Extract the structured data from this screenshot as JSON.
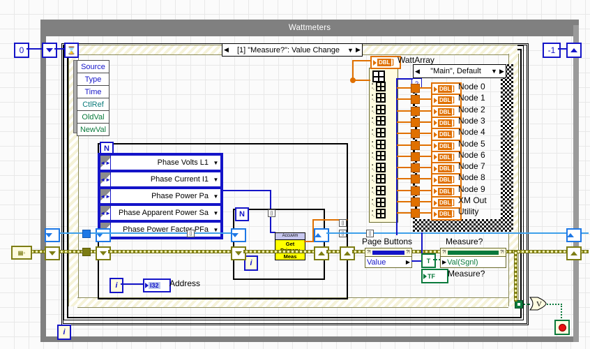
{
  "window": {
    "title": "Wattmeters"
  },
  "event_structure": {
    "case_label": "[1] \"Measure?\": Value Change",
    "left_arrow": "◀",
    "right_arrow": "▶",
    "dropdown_arrow": "▼",
    "timeout_icon": "⌛",
    "data_node": [
      {
        "label": "Source",
        "color": "#1414c8"
      },
      {
        "label": "Type",
        "color": "#1414c8"
      },
      {
        "label": "Time",
        "color": "#1414c8"
      },
      {
        "label": "CtlRef",
        "color": "#0a7a7a"
      },
      {
        "label": "OldVal",
        "color": "#0a7a3c"
      },
      {
        "label": "NewVal",
        "color": "#0a7a3c"
      }
    ]
  },
  "constants": {
    "timeout_value": "0",
    "negative_one": "-1",
    "iteration_terminal": "i",
    "for_loop_count": "N",
    "true_constant": "T",
    "boolean_tf": "TF",
    "selector_question": "?"
  },
  "enum_selectors": [
    {
      "label": "Phase Volts L1"
    },
    {
      "label": "Phase Current I1"
    },
    {
      "label": "Phase Power Pa"
    },
    {
      "label": "Phase Apparent Power Sa"
    },
    {
      "label": "Phase Power Factor PFa"
    }
  ],
  "watt_array": {
    "label": "WattArray",
    "type_tag": "DBL"
  },
  "case_structure": {
    "case_label": "\"Main\", Default",
    "left_arrow": "◀",
    "right_arrow": "▶",
    "dropdown_arrow": "▼"
  },
  "node_indicators": [
    {
      "label": "Node 0",
      "type": "DBL"
    },
    {
      "label": "Node 1",
      "type": "DBL"
    },
    {
      "label": "Node 2",
      "type": "DBL"
    },
    {
      "label": "Node 3",
      "type": "DBL"
    },
    {
      "label": "Node 4",
      "type": "DBL"
    },
    {
      "label": "Node 5",
      "type": "DBL"
    },
    {
      "label": "Node 6",
      "type": "DBL"
    },
    {
      "label": "Node 7",
      "type": "DBL"
    },
    {
      "label": "Node 8",
      "type": "DBL"
    },
    {
      "label": "Node 9",
      "type": "DBL"
    },
    {
      "label": "XM Out",
      "type": "DBL"
    },
    {
      "label": "Utility",
      "type": "DBL"
    }
  ],
  "subvi": {
    "header": "Accuvim",
    "line1": "Get",
    "line2": "Primary",
    "line3": "Meas"
  },
  "address": {
    "label": "Address",
    "type_tag": "I32"
  },
  "page_buttons": {
    "label": "Page Buttons",
    "property": "Value",
    "marker": "?!"
  },
  "measure": {
    "label": "Measure?",
    "property": "Val(Sgnl)",
    "terminal_label": "Measure?",
    "marker": "?!"
  },
  "or_gate": {
    "label": "V"
  },
  "stop": {
    "label": "stop-button"
  },
  "error_terminal": {
    "label": "▤"
  },
  "colors": {
    "window_frame": "#808080",
    "canvas": "#fbfbfb",
    "blue_wire": "#1414c8",
    "orange_wire": "#e07000",
    "light_blue_wire": "#3ea0ea",
    "error_wire": "#8a8a14",
    "boolean_wire": "#0a7a3c",
    "subvi_yellow": "#ffff00",
    "stop_red": "#e81010"
  }
}
